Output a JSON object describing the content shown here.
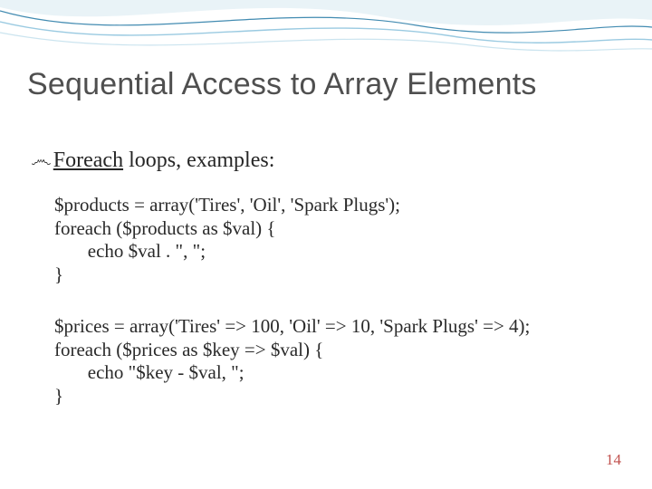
{
  "title": "Sequential Access to Array Elements",
  "subhead": {
    "bullet": "෴",
    "underlined": "Foreach",
    "rest": " loops, examples:"
  },
  "code1": {
    "l1": "$products = array('Tires', 'Oil', 'Spark Plugs');",
    "l2": "foreach ($products as $val) {",
    "l3": "       echo $val . \", \";",
    "l4": "}"
  },
  "code2": {
    "l1": "$prices = array('Tires' => 100, 'Oil' => 10, 'Spark Plugs' => 4);",
    "l2": "foreach ($prices as $key => $val) {",
    "l3": "       echo \"$key - $val, \";",
    "l4": "}"
  },
  "pagenum": "14"
}
